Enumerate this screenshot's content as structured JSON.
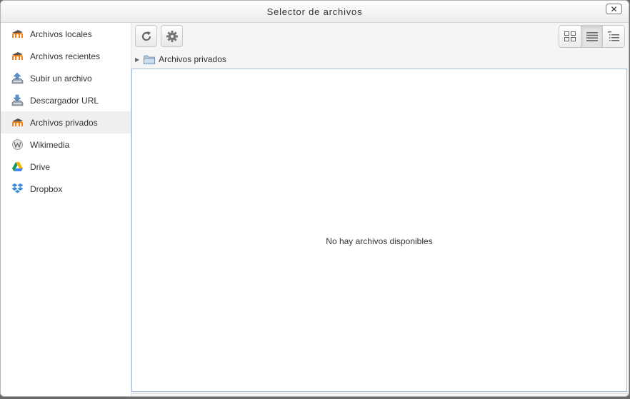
{
  "dialog": {
    "title": "Selector de archivos",
    "close_label": "✕"
  },
  "sidebar": {
    "items": [
      {
        "label": "Archivos locales",
        "icon": "moodle-icon",
        "active": false
      },
      {
        "label": "Archivos recientes",
        "icon": "moodle-icon",
        "active": false
      },
      {
        "label": "Subir un archivo",
        "icon": "upload-icon",
        "active": false
      },
      {
        "label": "Descargador URL",
        "icon": "url-download-icon",
        "active": false
      },
      {
        "label": "Archivos privados",
        "icon": "moodle-icon",
        "active": true
      },
      {
        "label": "Wikimedia",
        "icon": "wikimedia-icon",
        "active": false
      },
      {
        "label": "Drive",
        "icon": "drive-icon",
        "active": false
      },
      {
        "label": "Dropbox",
        "icon": "dropbox-icon",
        "active": false
      }
    ]
  },
  "toolbar": {
    "refresh_icon": "refresh-icon",
    "settings_icon": "gear-icon",
    "views": [
      {
        "icon": "icon-view-icon",
        "active": false
      },
      {
        "icon": "list-view-icon",
        "active": true
      },
      {
        "icon": "tree-view-icon",
        "active": false
      }
    ]
  },
  "path": {
    "label": "Archivos privados"
  },
  "content": {
    "empty_message": "No hay archivos disponibles"
  },
  "colors": {
    "moodle_orange": "#f98012",
    "drive_green": "#0f9d58",
    "drive_yellow": "#f4b400",
    "drive_blue": "#4285f4",
    "dropbox_blue": "#3d8bd6",
    "content_border": "#a7bede"
  }
}
